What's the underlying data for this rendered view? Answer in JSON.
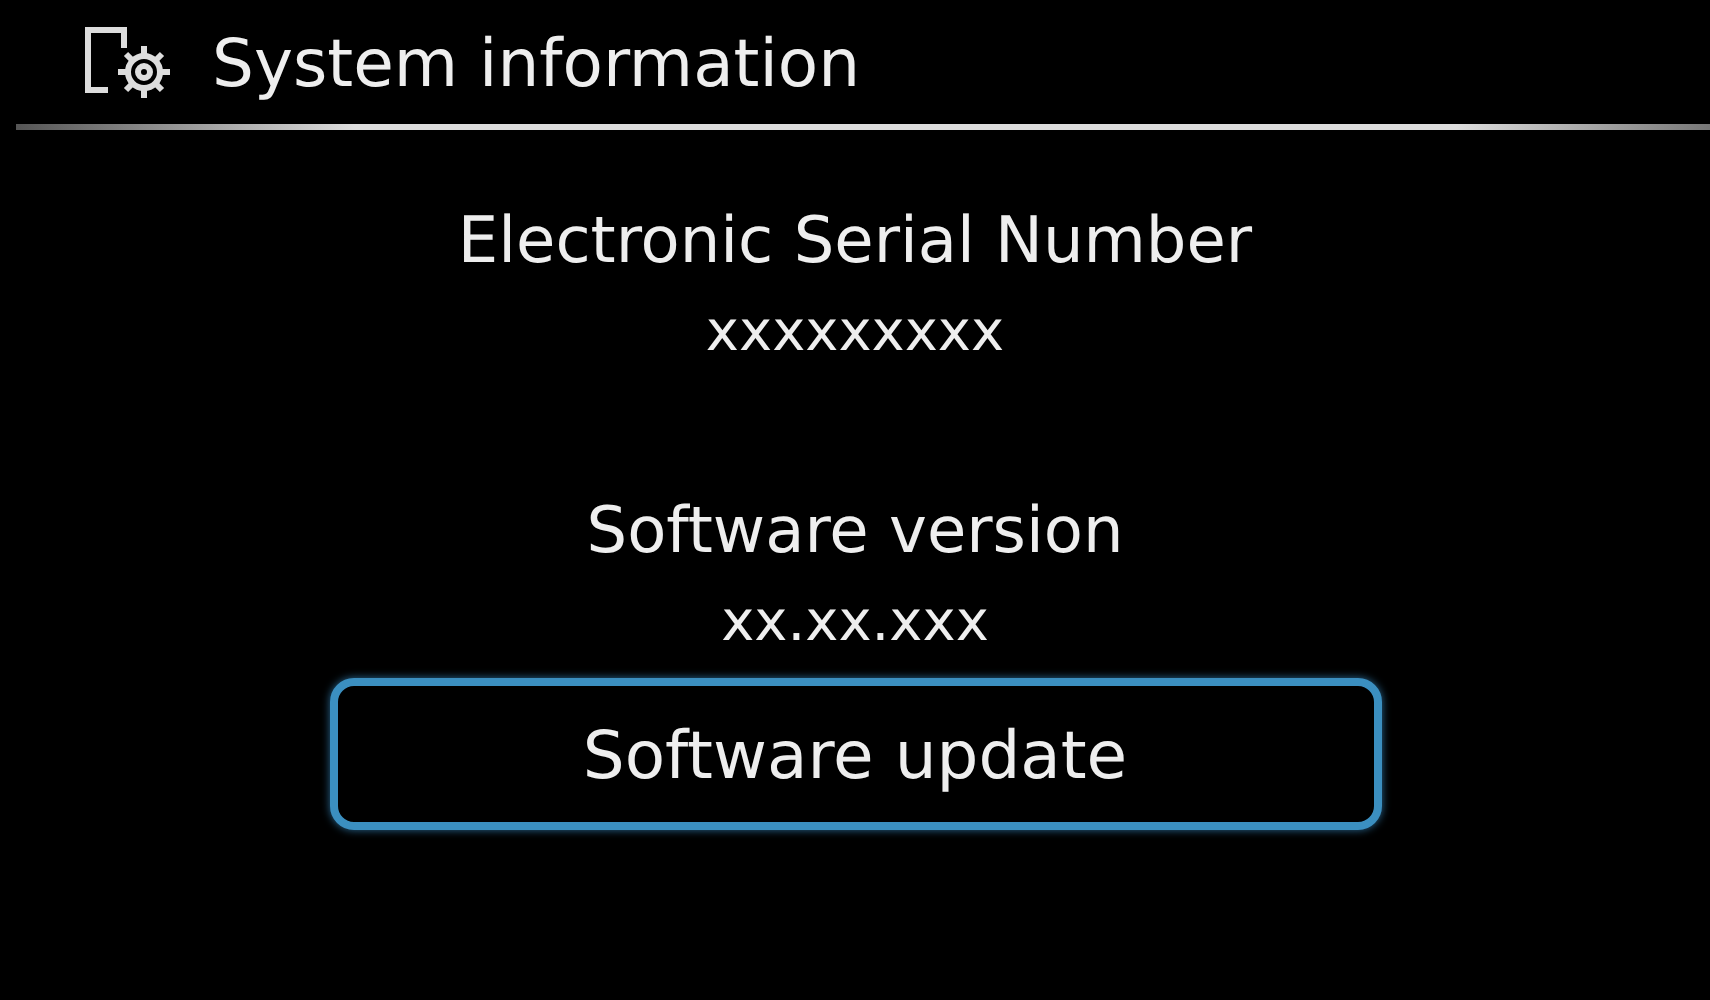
{
  "header": {
    "title": "System information"
  },
  "info": [
    {
      "label": "Electronic Serial Number",
      "value": "xxxxxxxxx"
    },
    {
      "label": "Software version",
      "value": "xx.xx.xxx"
    }
  ],
  "button": {
    "label": "Software update",
    "focused": true
  }
}
